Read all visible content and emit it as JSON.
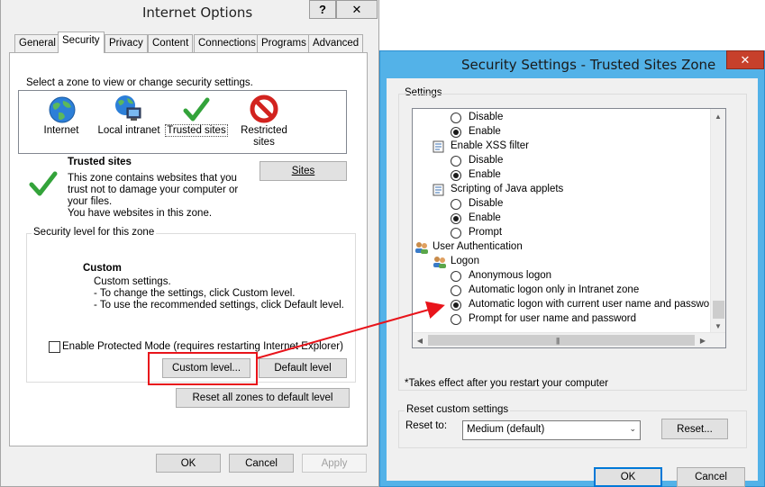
{
  "internet_options": {
    "title": "Internet Options",
    "help_button": "?",
    "close_button": "✕",
    "tabs": [
      "General",
      "Security",
      "Privacy",
      "Content",
      "Connections",
      "Programs",
      "Advanced"
    ],
    "zone_prompt": "Select a zone to view or change security settings.",
    "zones": [
      "Internet",
      "Local intranet",
      "Trusted sites",
      "Restricted sites"
    ],
    "zone_title": "Trusted sites",
    "zone_description": [
      "This zone contains websites that you",
      "trust not to damage your computer or",
      "your files.",
      "You have websites in this zone."
    ],
    "sites_button": "Sites",
    "security_level_label": "Security level for this zone",
    "level_title": "Custom",
    "level_lines": [
      "Custom settings.",
      "- To change the settings, click Custom level.",
      "- To use the recommended settings, click Default level."
    ],
    "protected_mode_label": "Enable Protected Mode (requires restarting Internet Explorer)",
    "protected_mode_checked": false,
    "custom_level_button": "Custom level...",
    "default_level_button": "Default level",
    "reset_all_button": "Reset all zones to default level",
    "ok_button": "OK",
    "cancel_button": "Cancel",
    "apply_button": "Apply"
  },
  "security_settings": {
    "title": "Security Settings - Trusted Sites Zone",
    "close_button": "✕",
    "settings_label": "Settings",
    "items": [
      {
        "kind": "radio",
        "label": "Disable",
        "checked": false
      },
      {
        "kind": "radio",
        "label": "Enable",
        "checked": true
      },
      {
        "kind": "header",
        "label": "Enable XSS filter",
        "icon": "script-setting-icon"
      },
      {
        "kind": "radio",
        "label": "Disable",
        "checked": false
      },
      {
        "kind": "radio",
        "label": "Enable",
        "checked": true
      },
      {
        "kind": "header",
        "label": "Scripting of Java applets",
        "icon": "script-setting-icon"
      },
      {
        "kind": "radio",
        "label": "Disable",
        "checked": false
      },
      {
        "kind": "radio",
        "label": "Enable",
        "checked": true
      },
      {
        "kind": "radio",
        "label": "Prompt",
        "checked": false
      },
      {
        "kind": "category",
        "label": "User Authentication",
        "icon": "users-icon"
      },
      {
        "kind": "header",
        "label": "Logon",
        "icon": "users-icon"
      },
      {
        "kind": "radio",
        "label": "Anonymous logon",
        "checked": false
      },
      {
        "kind": "radio",
        "label": "Automatic logon only in Intranet zone",
        "checked": false
      },
      {
        "kind": "radio",
        "label": "Automatic logon with current user name and password",
        "checked": true
      },
      {
        "kind": "radio",
        "label": "Prompt for user name and password",
        "checked": false
      }
    ],
    "restart_note": "*Takes effect after you restart your computer",
    "reset_group_label": "Reset custom settings",
    "reset_to_label": "Reset to:",
    "reset_to_value": "Medium (default)",
    "reset_button": "Reset...",
    "ok_button": "OK",
    "cancel_button": "Cancel"
  },
  "colors": {
    "highlight": "#e8141b",
    "accent_border": "#53b2e8",
    "default_button": "#0078d7"
  }
}
